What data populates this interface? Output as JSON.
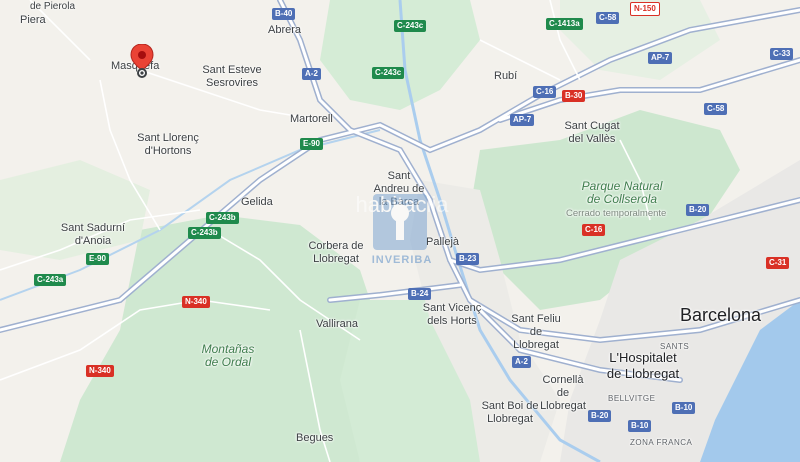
{
  "map": {
    "cities": [
      {
        "key": "barcelona",
        "name": "Barcelona"
      },
      {
        "key": "lhospitalet",
        "name": "L'Hospitalet de Llobregat"
      }
    ],
    "towns": {
      "piera": "Piera",
      "abrera": "Abrera",
      "rubi": "Rubí",
      "masquefa": "Masquefa",
      "sant_esteve": "Sant Esteve Sesrovires",
      "martorell": "Martorell",
      "sant_cugat": "Sant Cugat del Vallès",
      "sant_llorenc": "Sant Llorenç d'Hortons",
      "sant_andreu": "Sant Andreu de la Barca",
      "gelida": "Gelida",
      "sant_sadurni": "Sant Sadurní d'Anoia",
      "corbera": "Corbera de Llobregat",
      "palleja": "Pallejà",
      "vallirana": "Vallirana",
      "sant_vicenc": "Sant Vicenç dels Horts",
      "sant_feliu": "Sant Feliu de Llobregat",
      "cornella": "Cornellà de Llobregat",
      "sant_boi": "Sant Boi de Llobregat",
      "begues": "Begues",
      "de_pierola": "de Pierola"
    },
    "parks": {
      "collserola": "Parque Natural de Collserola",
      "collserola_note": "Cerrado temporalmente",
      "ordal": "Montañas de Ordal"
    },
    "zones": {
      "bellvitge": "BELLVITGE",
      "zona_franca": "ZONA FRANCA",
      "sants": "SANTS"
    },
    "roads": [
      "B-40",
      "N-150",
      "C-243c",
      "C-1413a",
      "C-58",
      "AP-7",
      "C-33",
      "A-2",
      "C-16",
      "B-30",
      "E-90",
      "C-243b",
      "B-20",
      "C-31",
      "N-340",
      "C-243a",
      "B-23",
      "B-24",
      "B-10"
    ],
    "watermark": {
      "text": "habitaclia",
      "brand": "INVERIBA"
    },
    "pin": {
      "label": "Masquefa",
      "icon": "location-pin-icon",
      "color": "#ea4335"
    },
    "colors": {
      "land": "#f1efe9",
      "green": "#d3ebd5",
      "water": "#9fc5ea",
      "highway": "#ffffff",
      "highway_edge": "#a8b6cf"
    }
  }
}
